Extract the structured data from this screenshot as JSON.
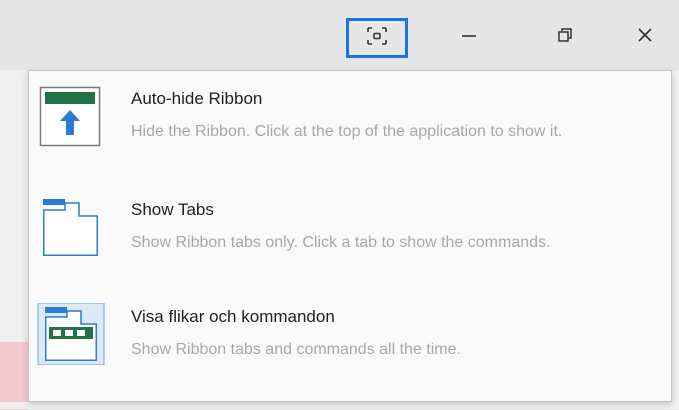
{
  "window": {
    "controls": {
      "ribbon_display_options_icon": "ribbon-display-options-icon",
      "minimize_icon": "minimize-icon",
      "restore_icon": "restore-icon",
      "close_icon": "close-icon"
    },
    "accent_color": "#1a73e8"
  },
  "menu": {
    "items": [
      {
        "title": "Auto-hide Ribbon",
        "description": "Hide the Ribbon. Click at the top of the application to show it.",
        "icon": "auto-hide-ribbon-icon"
      },
      {
        "title": "Show Tabs",
        "description": "Show Ribbon tabs only. Click a tab to show the commands.",
        "icon": "show-tabs-icon"
      },
      {
        "title": "Visa flikar och kommandon",
        "description": "Show Ribbon tabs and commands all the time.",
        "icon": "show-tabs-and-commands-icon"
      }
    ],
    "colors": {
      "ribbon_green": "#217346",
      "tab_blue": "#2b7cd3",
      "title": "#1f1f1f",
      "description": "#a8a8a8"
    }
  }
}
